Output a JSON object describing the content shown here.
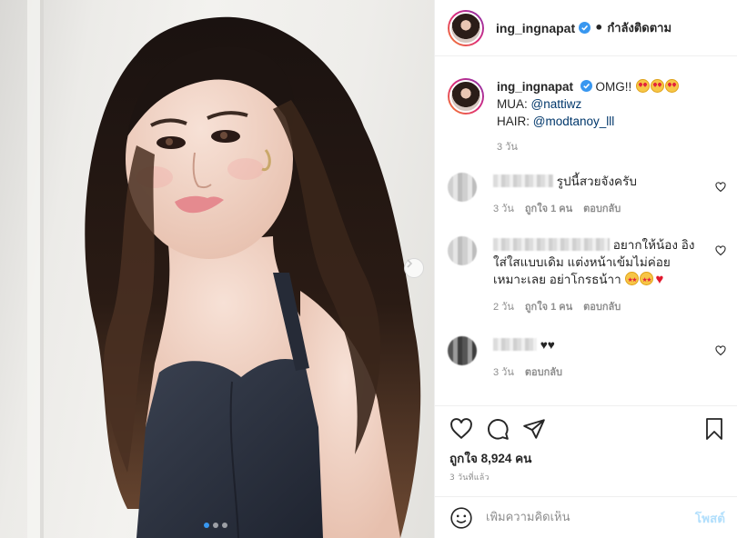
{
  "post": {
    "username": "ing_ingnapat",
    "separator": "•",
    "follow_status": "กำลังติดตาม",
    "caption": {
      "username": "ing_ingnapat",
      "text": "OMG!!",
      "emojis": [
        "heart-eyes",
        "heart-eyes",
        "heart-eyes"
      ],
      "mua_label": "MUA:",
      "mua_handle": "@nattiwz",
      "hair_label": "HAIR:",
      "hair_handle": "@modtanoy_lll",
      "time": "3 วัน"
    },
    "comments": [
      {
        "text": "รูปนี้สวยจังครับ",
        "time": "3 วัน",
        "likes": "ถูกใจ 1 คน",
        "reply": "ตอบกลับ"
      },
      {
        "text_line1": "อยากให้น้อง",
        "text_rest": "อิงใส่ใสแบบเดิม แต่งหน้าเข้มไม่ค่อยเหมาะเลย อย่าโกรธน้าา",
        "emojis": [
          "star-struck",
          "star-struck",
          "red-heart"
        ],
        "time": "2 วัน",
        "likes": "ถูกใจ 1 คน",
        "reply": "ตอบกลับ"
      },
      {
        "text": "♥♥",
        "time": "3 วัน",
        "reply": "ตอบกลับ"
      }
    ],
    "likes_count": "ถูกใจ 8,924 คน",
    "posted_ago": "3 วันที่แล้ว",
    "add_comment_placeholder": "เพิ่มความคิดเห็น",
    "post_button": "โพสต์",
    "carousel": {
      "slides": 3,
      "active_slide": 1
    }
  },
  "icons": {
    "verified": "verified-badge-icon",
    "like": "heart-outline-icon",
    "comment": "comment-bubble-icon",
    "share": "paper-plane-icon",
    "save": "bookmark-icon",
    "emoji": "smiley-icon",
    "next": "chevron-right-icon"
  },
  "colors": {
    "link": "#00376b",
    "verified": "#3897f0",
    "muted": "#8e8e8e",
    "post_button": "#b2dffc"
  }
}
